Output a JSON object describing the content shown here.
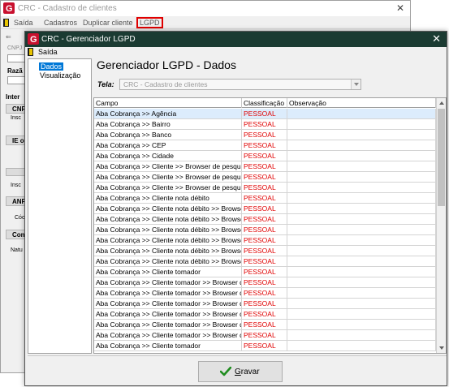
{
  "background_window": {
    "title": "CRC - Cadastro de clientes",
    "menu": [
      "Saída",
      "Cadastros",
      "Duplicar cliente",
      "LGPD"
    ],
    "left_labels": [
      "CNPJ",
      "Razã",
      "Inter",
      "CNP",
      "Insc",
      "IE o",
      "Insc",
      "ANP",
      "Cóc",
      "Con",
      "Natu"
    ]
  },
  "dialog": {
    "title": "CRC - Gerenciador LGPD",
    "menu_exit": "Saída",
    "nav": [
      "Dados",
      "Visualização"
    ],
    "heading": "Gerenciador LGPD - Dados",
    "tela_label": "Tela:",
    "tela_value": "CRC - Cadastro de clientes",
    "columns": [
      "Campo",
      "Classificação",
      "Observação"
    ],
    "rows": [
      {
        "campo": "Aba Cobrança >> Agência",
        "classificacao": "PESSOAL",
        "observacao": ""
      },
      {
        "campo": "Aba Cobrança >> Bairro",
        "classificacao": "PESSOAL",
        "observacao": ""
      },
      {
        "campo": "Aba Cobrança >> Banco",
        "classificacao": "PESSOAL",
        "observacao": ""
      },
      {
        "campo": "Aba Cobrança >> CEP",
        "classificacao": "PESSOAL",
        "observacao": ""
      },
      {
        "campo": "Aba Cobrança >> Cidade",
        "classificacao": "PESSOAL",
        "observacao": ""
      },
      {
        "campo": "Aba Cobrança >> Cliente >> Browser de pesquisa ...",
        "classificacao": "PESSOAL",
        "observacao": ""
      },
      {
        "campo": "Aba Cobrança >> Cliente >> Browser de pesquisa ...",
        "classificacao": "PESSOAL",
        "observacao": ""
      },
      {
        "campo": "Aba Cobrança >> Cliente >> Browser de pesquisa ...",
        "classificacao": "PESSOAL",
        "observacao": ""
      },
      {
        "campo": "Aba Cobrança >> Cliente nota débito",
        "classificacao": "PESSOAL",
        "observacao": ""
      },
      {
        "campo": "Aba Cobrança >> Cliente nota débito >> Browser d...",
        "classificacao": "PESSOAL",
        "observacao": ""
      },
      {
        "campo": "Aba Cobrança >> Cliente nota débito >> Browser d...",
        "classificacao": "PESSOAL",
        "observacao": ""
      },
      {
        "campo": "Aba Cobrança >> Cliente nota débito >> Browser d...",
        "classificacao": "PESSOAL",
        "observacao": ""
      },
      {
        "campo": "Aba Cobrança >> Cliente nota débito >> Browser d...",
        "classificacao": "PESSOAL",
        "observacao": ""
      },
      {
        "campo": "Aba Cobrança >> Cliente nota débito >> Browser d...",
        "classificacao": "PESSOAL",
        "observacao": ""
      },
      {
        "campo": "Aba Cobrança >> Cliente nota débito >> Browser d...",
        "classificacao": "PESSOAL",
        "observacao": ""
      },
      {
        "campo": "Aba Cobrança >> Cliente tomador",
        "classificacao": "PESSOAL",
        "observacao": ""
      },
      {
        "campo": "Aba Cobrança >> Cliente tomador >> Browser de p...",
        "classificacao": "PESSOAL",
        "observacao": ""
      },
      {
        "campo": "Aba Cobrança >> Cliente tomador >> Browser de p...",
        "classificacao": "PESSOAL",
        "observacao": ""
      },
      {
        "campo": "Aba Cobrança >> Cliente tomador >> Browser de p...",
        "classificacao": "PESSOAL",
        "observacao": ""
      },
      {
        "campo": "Aba Cobrança >> Cliente tomador >> Browser de p...",
        "classificacao": "PESSOAL",
        "observacao": ""
      },
      {
        "campo": "Aba Cobrança >> Cliente tomador >> Browser de p...",
        "classificacao": "PESSOAL",
        "observacao": ""
      },
      {
        "campo": "Aba Cobrança >> Cliente tomador >> Browser de p...",
        "classificacao": "PESSOAL",
        "observacao": ""
      },
      {
        "campo": "Aba Cobrança >> Cliente tomador",
        "classificacao": "PESSOAL",
        "observacao": ""
      }
    ],
    "save_button_prefix": "",
    "save_button_hotkey": "G",
    "save_button_rest": "ravar"
  },
  "colors": {
    "dialog_titlebar": "#1b3b32",
    "classification": "#e00000",
    "selected_nav": "#0078d7",
    "highlight_border": "#e00000"
  },
  "icons": {
    "app_logo": "app-logo-icon",
    "exit": "exit-door-icon",
    "close": "close-icon",
    "save": "checkmark-icon"
  }
}
